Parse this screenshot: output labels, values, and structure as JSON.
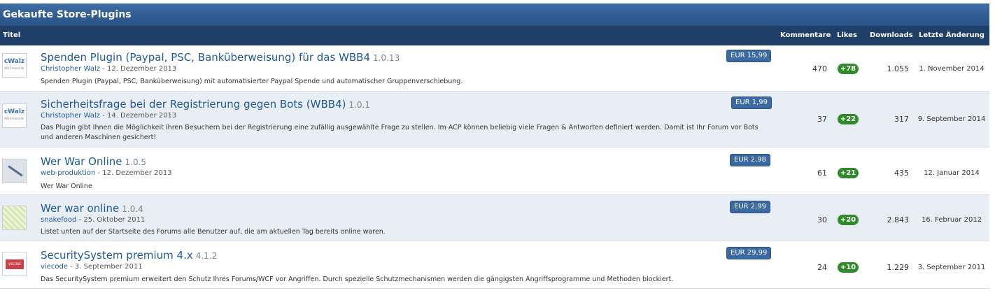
{
  "window": {
    "title": "Gekaufte Store-Plugins"
  },
  "columns": {
    "title": "Titel",
    "comments": "Kommentare",
    "likes": "Likes",
    "downloads": "Downloads",
    "last_change": "Letzte Änderung"
  },
  "rows": [
    {
      "title": "Spenden Plugin (Paypal, PSC, Banküberweisung) für das WBB4",
      "version": "1.0.13",
      "author": "Christopher Walz",
      "date": " - 12. Dezember 2013",
      "description": "Spenden Plugin (Paypal, PSC, Banküberweisung) mit automatisierter Paypal Spende und automatischer Gruppenverschiebung.",
      "price": "EUR 15,99",
      "comments": "470",
      "likes": "+78",
      "downloads": "1.055",
      "last_change": "1. November 2014",
      "icon": "cwalz-logo-icon"
    },
    {
      "title": "Sicherheitsfrage bei der Registrierung gegen Bots (WBB4)",
      "version": "1.0.1",
      "author": "Christopher Walz",
      "date": " - 14. Dezember 2013",
      "description": "Das Plugin gibt Ihnen die Möglichkeit Ihren Besuchern bei der Registrierung eine zufällig ausgewählte Frage zu stellen. Im ACP können beliebig viele Fragen & Antworten definiert werden. Damit ist Ihr Forum vor Bots und anderen Maschinen gesichert!",
      "price": "EUR 1,99",
      "comments": "37",
      "likes": "+22",
      "downloads": "317",
      "last_change": "9. September 2014",
      "icon": "cwalz-logo-icon"
    },
    {
      "title": "Wer War Online",
      "version": "1.0.5",
      "author": "web-produktion",
      "date": " - 12. Dezember 2013",
      "description": "Wer War Online",
      "price": "EUR 2,98",
      "comments": "61",
      "likes": "+21",
      "downloads": "435",
      "last_change": "12. Januar 2014",
      "icon": "plugin-thumbnail-icon"
    },
    {
      "title": "Wer war online",
      "version": "1.0.4",
      "author": "snakefood",
      "date": " - 25. Oktober 2011",
      "description": "Listet unten auf der Startseite des Forums alle Benutzer auf, die am aktuellen Tag bereits online waren.",
      "price": "EUR 2,99",
      "comments": "30",
      "likes": "+20",
      "downloads": "2.843",
      "last_change": "16. Februar 2012",
      "icon": "plugin-thumbnail-icon"
    },
    {
      "title": "SecuritySystem premium 4.x",
      "version": "4.1.2",
      "author": "viecode",
      "date": " - 3. September 2011",
      "description": "Das SecuritySystem premium erweitert den Schutz Ihres Forums/WCF vor Angriffen. Durch spezielle Schutzmechanismen werden die gängigsten Angriffsprogramme und Methoden blockiert.",
      "price": "EUR 29,99",
      "comments": "24",
      "likes": "+10",
      "downloads": "1.229",
      "last_change": "3. September 2011",
      "icon": "viecode-logo-icon"
    }
  ],
  "colors": {
    "header": "#2f5c92",
    "column_header": "#1f3f68",
    "link": "#1f5a9c",
    "price_badge": "#3a6aa1",
    "likes_badge": "#2f8a2a"
  }
}
